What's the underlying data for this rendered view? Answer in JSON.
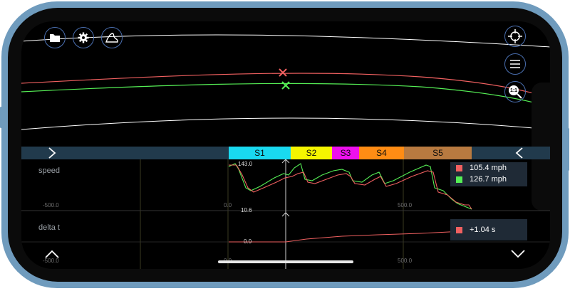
{
  "toolbar": {
    "left_icons": [
      "folder-icon",
      "gear-icon",
      "track-shape-icon"
    ],
    "right_icons": [
      "crosshair-icon",
      "menu-icon",
      "zoom-1to1-icon"
    ],
    "zoom_label": "1:1"
  },
  "sectors": [
    {
      "label": "S1",
      "color": "#19d9f0"
    },
    {
      "label": "S2",
      "color": "#f5f500"
    },
    {
      "label": "S3",
      "color": "#ee10ee"
    },
    {
      "label": "S4",
      "color": "#ff8c14"
    },
    {
      "label": "S5",
      "color": "#b87a40"
    }
  ],
  "speed_panel": {
    "label": "speed",
    "cursor_max": "143.0",
    "cursor_min": "10.6",
    "x_ticks": [
      "-500.0",
      "0.0",
      "500.0"
    ],
    "legend": [
      {
        "value": "105.4 mph",
        "color": "#f06060"
      },
      {
        "value": "126.7 mph",
        "color": "#55ee55"
      }
    ]
  },
  "delta_panel": {
    "label": "delta t",
    "cursor_value": "0.0",
    "x_ticks": [
      "-500.0",
      "0.0",
      "500.0"
    ],
    "legend": [
      {
        "value": "+1.04 s",
        "color": "#f06060"
      }
    ]
  },
  "colors": {
    "lap_red": "#f06060",
    "lap_green": "#55ee55",
    "track_edge": "#ffffff",
    "bar_bg": "#213a4c",
    "icon_ring": "#4a6fb0"
  }
}
